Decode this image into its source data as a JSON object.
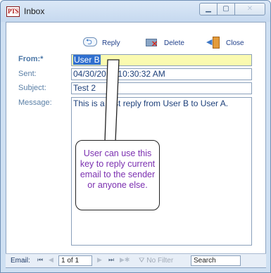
{
  "window": {
    "title": "Inbox",
    "app_icon_text": "PTS"
  },
  "toolbar": {
    "reply_label": "Reply",
    "delete_label": "Delete",
    "close_label": "Close"
  },
  "fields": {
    "from_label": "From:*",
    "from_value": "User B",
    "sent_label": "Sent:",
    "sent_value": "04/30/2017 10:30:32 AM",
    "subject_label": "Subject:",
    "subject_value": "Test 2",
    "message_label": "Message:",
    "message_value": "This is a test reply from User B to User A."
  },
  "callout": {
    "text": "User can use this key to reply current email to the sender or anyone else."
  },
  "navbar": {
    "label": "Email:",
    "record": "1 of 1",
    "filter_label": "No Filter",
    "search_label": "Search"
  },
  "icons": {
    "reply": "reply-icon",
    "delete": "delete-icon",
    "close": "close-door-icon",
    "first": "first-record-icon",
    "prev": "previous-record-icon",
    "next": "next-record-icon",
    "last": "last-record-icon",
    "new": "new-record-icon",
    "filter": "filter-icon"
  }
}
